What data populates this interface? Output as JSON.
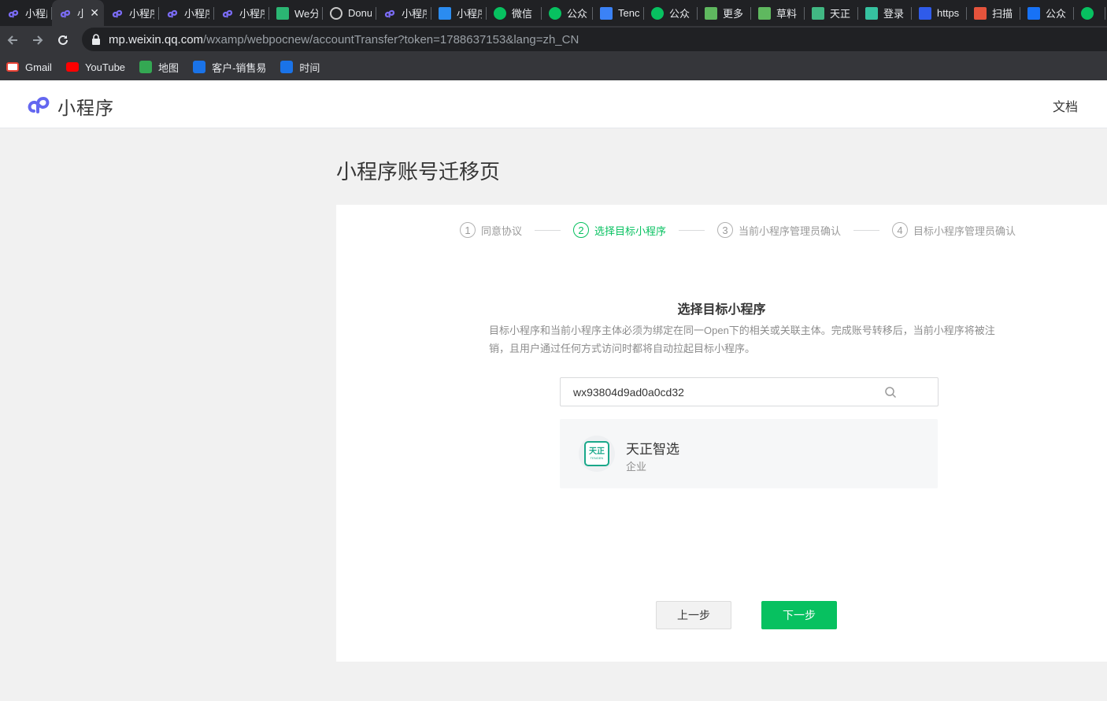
{
  "browser": {
    "tabs": [
      {
        "label": "小程序",
        "icon": "miniprogram-icon",
        "color": "#7b6cf6"
      },
      {
        "label": "小",
        "icon": "miniprogram-icon",
        "color": "#7b6cf6",
        "active": true
      },
      {
        "label": "小程序",
        "icon": "miniprogram-icon",
        "color": "#7b6cf6"
      },
      {
        "label": "小程序",
        "icon": "miniprogram-icon",
        "color": "#7b6cf6"
      },
      {
        "label": "小程序",
        "icon": "miniprogram-icon",
        "color": "#7b6cf6"
      },
      {
        "label": "We分",
        "icon": "bars-icon",
        "color": "#2bb673"
      },
      {
        "label": "Donu",
        "icon": "globe-icon",
        "color": "#c8c8c8"
      },
      {
        "label": "小程序",
        "icon": "miniprogram-icon",
        "color": "#7b6cf6"
      },
      {
        "label": "小程序",
        "icon": "grid-icon",
        "color": "#2b8cf0"
      },
      {
        "label": "微信",
        "icon": "wechat-icon",
        "color": "#07c160"
      },
      {
        "label": "公众",
        "icon": "wechat-icon",
        "color": "#07c160"
      },
      {
        "label": "Tenc",
        "icon": "tencent-icon",
        "color": "#3b82f6"
      },
      {
        "label": "公众",
        "icon": "wechat-icon",
        "color": "#07c160"
      },
      {
        "label": "更多",
        "icon": "qr-icon",
        "color": "#5fb85f"
      },
      {
        "label": "草料",
        "icon": "qr-icon",
        "color": "#5fb85f"
      },
      {
        "label": "天正",
        "icon": "vue-icon",
        "color": "#41b883"
      },
      {
        "label": "登录",
        "icon": "dots-icon",
        "color": "#36c2a0"
      },
      {
        "label": "https",
        "icon": "paw-icon",
        "color": "#2f5bea"
      },
      {
        "label": "扫描",
        "icon": "c-icon",
        "color": "#e5533c"
      },
      {
        "label": "公众",
        "icon": "zhihu-icon",
        "color": "#1772f6"
      },
      {
        "label": "",
        "icon": "wechat-icon",
        "color": "#07c160"
      }
    ],
    "close_glyph": "✕",
    "url_host": "mp.weixin.qq.com",
    "url_path": "/wxamp/webpocnew/accountTransfer?token=1788637153&lang=zh_CN",
    "bookmarks": [
      {
        "label": "Gmail",
        "icon": "gmail-icon",
        "color": "#ea4335"
      },
      {
        "label": "YouTube",
        "icon": "youtube-icon",
        "color": "#ff0000"
      },
      {
        "label": "地图",
        "icon": "maps-icon",
        "color": "#34a853"
      },
      {
        "label": "客户-销售易",
        "icon": "arrow-icon",
        "color": "#1a73e8"
      },
      {
        "label": "时间",
        "icon": "arrow-icon",
        "color": "#1a73e8"
      }
    ]
  },
  "header": {
    "logo_text": "小程序",
    "doc_link": "文档"
  },
  "page": {
    "title": "小程序账号迁移页",
    "steps": [
      {
        "num": "1",
        "label": "同意协议",
        "active": false
      },
      {
        "num": "2",
        "label": "选择目标小程序",
        "active": true
      },
      {
        "num": "3",
        "label": "当前小程序管理员确认",
        "active": false
      },
      {
        "num": "4",
        "label": "目标小程序管理员确认",
        "active": false
      }
    ],
    "section_title": "选择目标小程序",
    "section_desc": "目标小程序和当前小程序主体必须为绑定在同一Open下的相关或关联主体。完成账号转移后，当前小程序将被注销，且用户通过任何方式访问时都将自动拉起目标小程序。",
    "search_value": "wx93804d9ad0a0cd32",
    "result": {
      "name": "天正智选",
      "type": "企业",
      "avatar_mark": "天正",
      "avatar_sub": "TENGEN"
    },
    "prev_button": "上一步",
    "next_button": "下一步"
  },
  "colors": {
    "accent": "#07c160",
    "logo": "#6467f0"
  }
}
